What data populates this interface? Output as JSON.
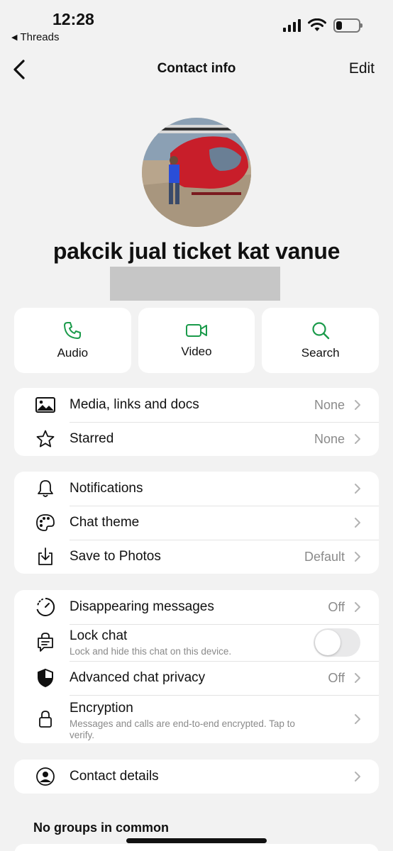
{
  "status": {
    "time": "12:28",
    "back_app": "Threads",
    "battery_level": 0.25
  },
  "nav": {
    "title": "Contact info",
    "edit_label": "Edit"
  },
  "profile": {
    "name": "pakcik jual ticket kat vanue"
  },
  "actions": [
    {
      "label": "Audio",
      "icon": "phone-icon"
    },
    {
      "label": "Video",
      "icon": "video-icon"
    },
    {
      "label": "Search",
      "icon": "search-icon"
    }
  ],
  "group1": [
    {
      "label": "Media, links and docs",
      "value": "None",
      "icon": "photo-icon"
    },
    {
      "label": "Starred",
      "value": "None",
      "icon": "star-icon"
    }
  ],
  "group2": [
    {
      "label": "Notifications",
      "value": "",
      "icon": "bell-icon"
    },
    {
      "label": "Chat theme",
      "value": "",
      "icon": "palette-icon"
    },
    {
      "label": "Save to Photos",
      "value": "Default",
      "icon": "download-icon"
    }
  ],
  "group3": {
    "disappearing": {
      "label": "Disappearing messages",
      "value": "Off"
    },
    "lock": {
      "label": "Lock chat",
      "sub": "Lock and hide this chat on this device.",
      "toggle_on": false
    },
    "privacy": {
      "label": "Advanced chat privacy",
      "value": "Off"
    },
    "encryption": {
      "label": "Encryption",
      "sub": "Messages and calls are end-to-end encrypted. Tap to verify."
    }
  },
  "contact_details": {
    "label": "Contact details"
  },
  "groups_heading": "No groups in common",
  "colors": {
    "accent": "#1a9a4a",
    "background": "#f2f2f2",
    "secondary_text": "#8a8a8a"
  }
}
